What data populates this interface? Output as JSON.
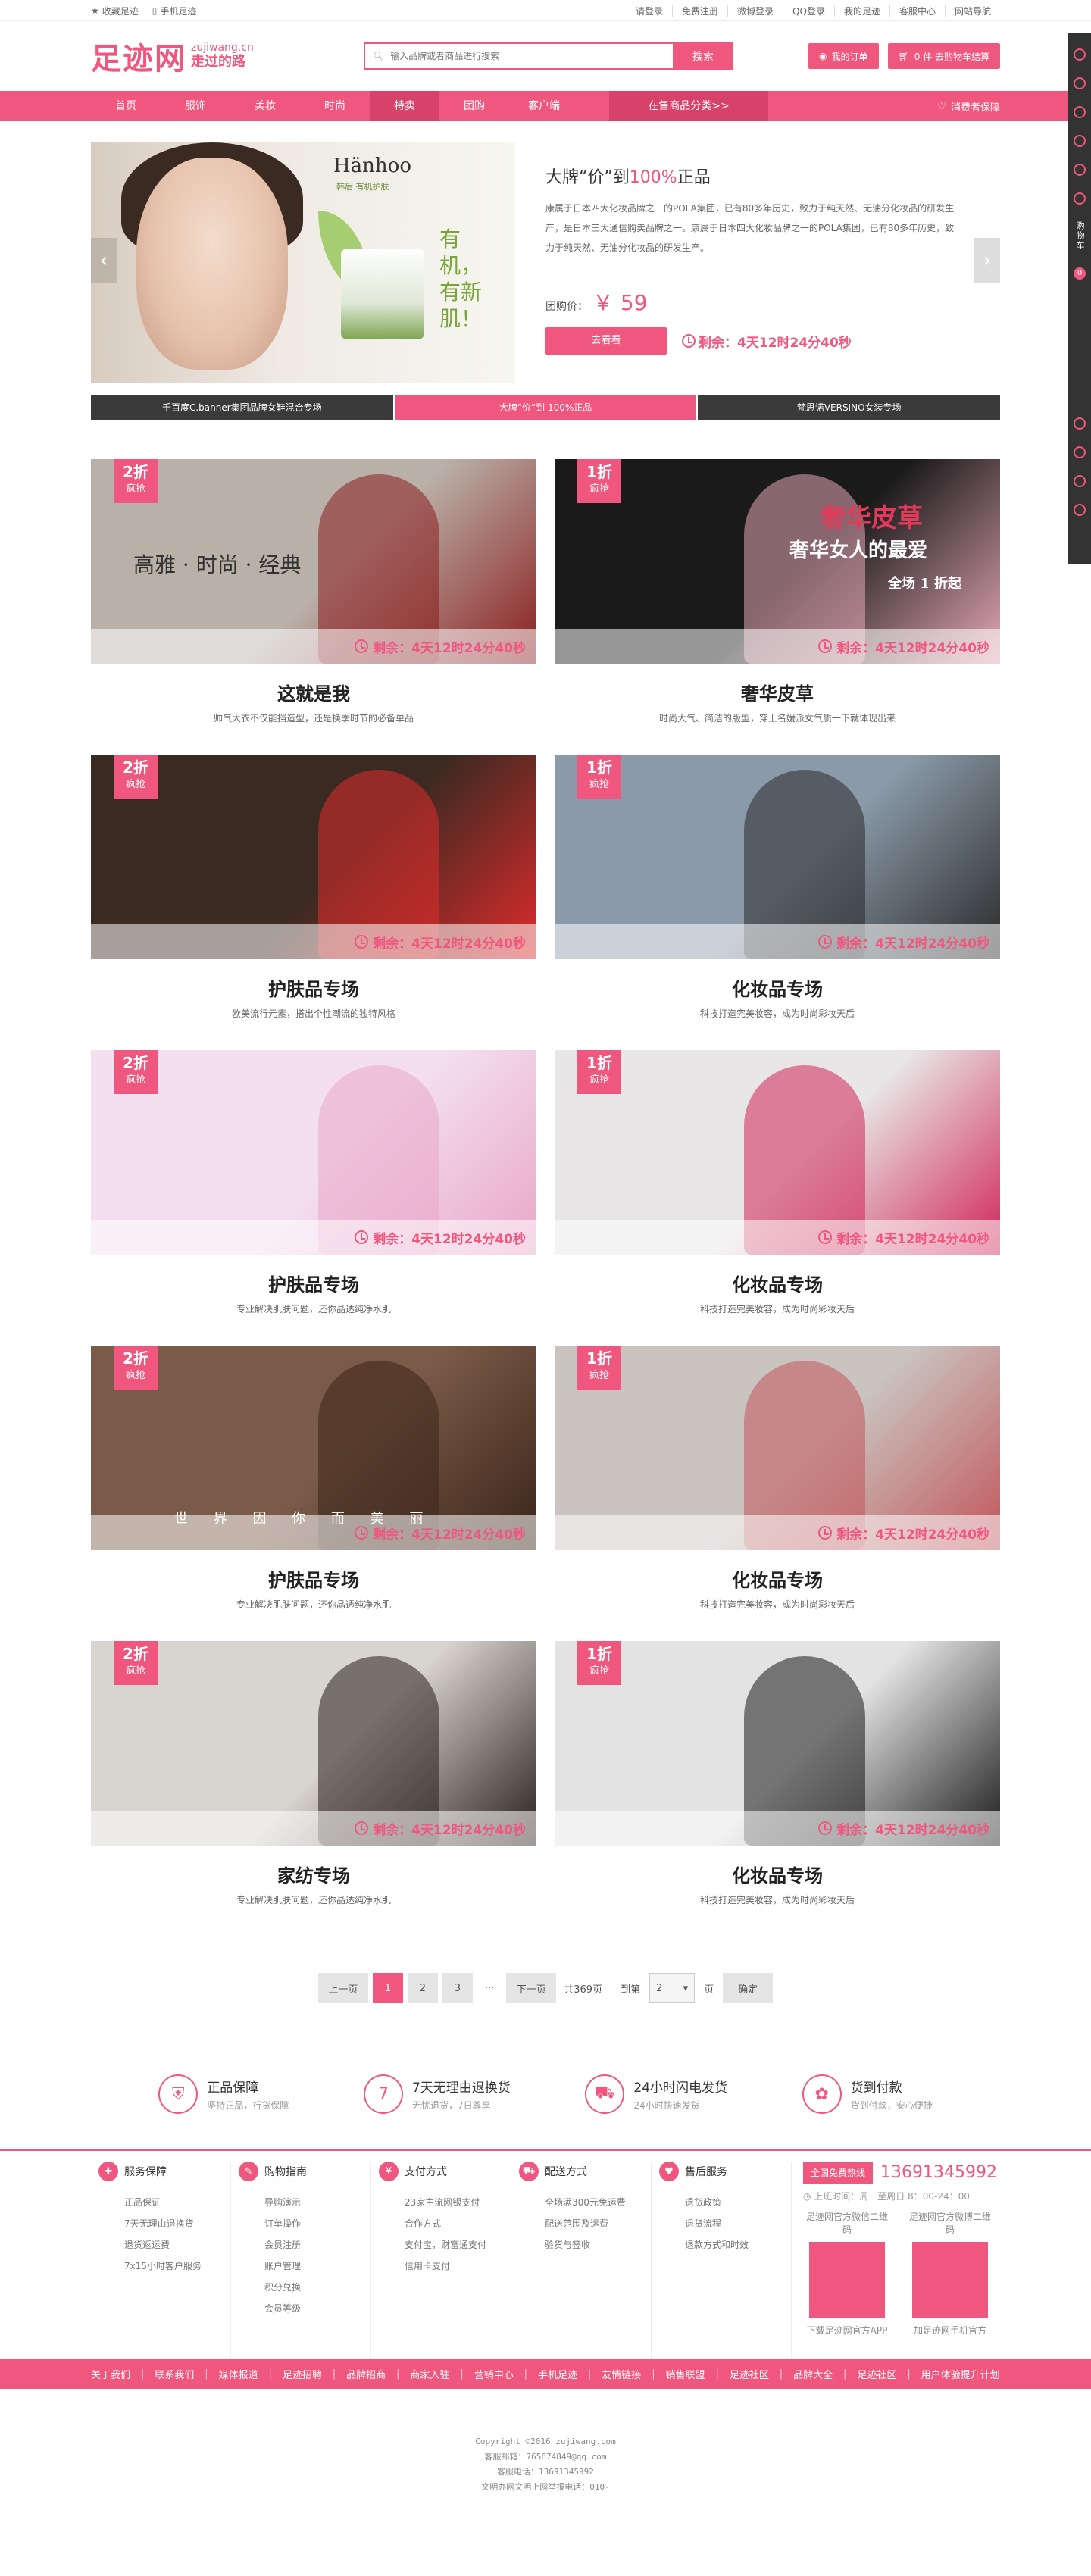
{
  "topbar": {
    "fav": "收藏足迹",
    "mobile": "手机足迹",
    "links": [
      "请登录",
      "免费注册",
      "微博登录",
      "QQ登录",
      "我的足迹",
      "客服中心",
      "网站导航"
    ]
  },
  "header": {
    "logo": "足迹网",
    "logo_url": "zujiwang.cn",
    "logo_slogan": "走过的路",
    "search_placeholder": "输入品牌或者商品进行搜索",
    "search_button": "搜索",
    "orders": "我的订单",
    "cart": "0 件  去购物车结算"
  },
  "nav": {
    "items": [
      "首页",
      "服饰",
      "美妆",
      "时尚",
      "特卖",
      "团购",
      "客户端"
    ],
    "active_index": 4,
    "categories": "在售商品分类>>",
    "guarantee": "消费者保障"
  },
  "hero": {
    "brand": "Hänhoo",
    "brand_sub": "韩后 有机护肤",
    "slogan": "有机，有新肌！",
    "title_pre": "大牌“价”到",
    "title_hl": "100%",
    "title_post": "正品",
    "desc": "康属于日本四大化妆品牌之一的POLA集团，已有80多年历史，致力于纯天然、无油分化妆品的研发生产，是日本三大通信购卖品牌之一。康属于日本四大化妆品牌之一的POLA集团，已有80多年历史，致力于纯天然、无油分化妆品的研发生产。",
    "price_label": "团购价：",
    "price": "￥ 59",
    "button": "去看看",
    "remain": "剩余：4天12时24分40秒",
    "tabs": [
      "千百度C.banner集团品牌女鞋混合专场",
      "大牌“价”到 100%正品",
      "梵思诺VERSINO女装专场"
    ],
    "tab_active": 1
  },
  "deals": [
    {
      "discount": "2折",
      "tag": "疯抢",
      "remain": "剩余：4天12时24分40秒",
      "title": "这就是我",
      "sub": "帅气大衣不仅能挡造型，还是换季时节的必备单品",
      "overlay": "高雅 · 时尚 · 经典",
      "bg": "#b9b0a8",
      "accent": "#8b1e1e"
    },
    {
      "discount": "1折",
      "tag": "疯抢",
      "remain": "剩余：4天12时24分40秒",
      "title": "奢华皮草",
      "sub": "时尚大气、简洁的版型，穿上名媛派女气质一下就体现出来",
      "overlay": "奢华皮草",
      "overlay2": "奢华女人的最爱",
      "overlay3": "全场 1 折起",
      "bg": "#1a1a1a",
      "accent": "#e6a8b8"
    },
    {
      "discount": "2折",
      "tag": "疯抢",
      "remain": "剩余：4天12时24分40秒",
      "title": "护肤品专场",
      "sub": "欧美流行元素，搭出个性潮流的独特风格",
      "bg": "#3a2a22",
      "accent": "#e02b2b"
    },
    {
      "discount": "1折",
      "tag": "疯抢",
      "remain": "剩余：4天12时24分40秒",
      "title": "化妆品专场",
      "sub": "科技打造完美妆容，成为时尚彩妆天后",
      "bg": "#8a9aa8",
      "accent": "#2a2a2a"
    },
    {
      "discount": "2折",
      "tag": "疯抢",
      "remain": "剩余：4天12时24分40秒",
      "title": "护肤品专场",
      "sub": "专业解决肌肤问题，还你晶透纯净水肌",
      "bg": "#f3dff0",
      "accent": "#e9a6c8"
    },
    {
      "discount": "1折",
      "tag": "疯抢",
      "remain": "剩余：4天12时24分40秒",
      "title": "化妆品专场",
      "sub": "科技打造完美妆容，成为时尚彩妆天后",
      "bg": "#e8e6e6",
      "accent": "#d0245a"
    },
    {
      "discount": "2折",
      "tag": "疯抢",
      "remain": "剩余：4天12时24分40秒",
      "title": "护肤品专场",
      "sub": "专业解决肌肤问题，还你晶透纯净水肌",
      "overlay": "世 界 因 你 而 美 丽",
      "bg": "#7a5a48",
      "accent": "#3a2418"
    },
    {
      "discount": "1折",
      "tag": "疯抢",
      "remain": "剩余：4天12时24分40秒",
      "title": "化妆品专场",
      "sub": "科技打造完美妆容，成为时尚彩妆天后",
      "bg": "#c9c4c0",
      "accent": "#c2555a"
    },
    {
      "discount": "2折",
      "tag": "疯抢",
      "remain": "剩余：4天12时24分40秒",
      "title": "家纺专场",
      "sub": "专业解决肌肤问题，还你晶透纯净水肌",
      "bg": "#d8d4d0",
      "accent": "#2a1e1a"
    },
    {
      "discount": "1折",
      "tag": "疯抢",
      "remain": "剩余：4天12时24分40秒",
      "title": "化妆品专场",
      "sub": "科技打造完美妆容，成为时尚彩妆天后",
      "bg": "#e3e3e3",
      "accent": "#1a1a1a"
    }
  ],
  "pager": {
    "prev": "上一页",
    "pages": [
      "1",
      "2",
      "3"
    ],
    "current": "1",
    "ellipsis": "···",
    "next": "下一页",
    "total": "共369页",
    "goto": "到第",
    "goto_value": "2",
    "page_unit": "页",
    "confirm": "确定"
  },
  "services": [
    {
      "icon": "shield",
      "title": "正品保障",
      "sub": "坚持正品，行货保障"
    },
    {
      "icon": "7",
      "title": "7天无理由退换货",
      "sub": "无忧退货，7日尊享"
    },
    {
      "icon": "truck",
      "title": "24小时闪电发货",
      "sub": "24小时快速发货"
    },
    {
      "icon": "bag",
      "title": "货到付款",
      "sub": "货到付款，安心便捷"
    }
  ],
  "footer": {
    "cols": [
      {
        "title": "服务保障",
        "items": [
          "正品保证",
          "7天无理由退换货",
          "退货返运费",
          "7x15小时客户服务"
        ]
      },
      {
        "title": "购物指南",
        "items": [
          "导购演示",
          "订单操作",
          "会员注册",
          "账户管理",
          "积分兑换",
          "会员等级"
        ]
      },
      {
        "title": "支付方式",
        "items": [
          "23家主流网银支付",
          "合作方式",
          "支付宝，财富通支付",
          "信用卡支付"
        ]
      },
      {
        "title": "配送方式",
        "items": [
          "全场满300元免运费",
          "配送范围及运费",
          "验货与签收"
        ]
      },
      {
        "title": "售后服务",
        "items": [
          "退货政策",
          "退货流程",
          "退款方式和时效"
        ]
      }
    ],
    "hot_label": "全国免费热线",
    "hot_phone": "13691345992",
    "hot_time": "上班时间：周一至周日 8：00-24：00",
    "qr": [
      {
        "title": "足迹网官方微信二维码",
        "caption": "下载足迹网官方APP"
      },
      {
        "title": "足迹网官方微博二维码",
        "caption": "加足迹网手机官方"
      }
    ],
    "bottom_nav": [
      "关于我们",
      "联系我们",
      "媒体报道",
      "足迹招聘",
      "品牌招商",
      "商家入驻",
      "营销中心",
      "手机足迹",
      "友情链接",
      "销售联盟",
      "足迹社区",
      "品牌大全",
      "足迹社区",
      "用户体验提升计划"
    ],
    "copyright": [
      "Copyright ©2016 zujiwang.com",
      "客服邮箱：765674849@qq.com",
      "客服电话：13691345992",
      "文明办网文明上网举报电话：010-"
    ]
  },
  "sidebar": {
    "cart": "购物车",
    "count": "0"
  },
  "colors": {
    "brand": "#f0577f",
    "brand_dark": "#d6426a"
  }
}
